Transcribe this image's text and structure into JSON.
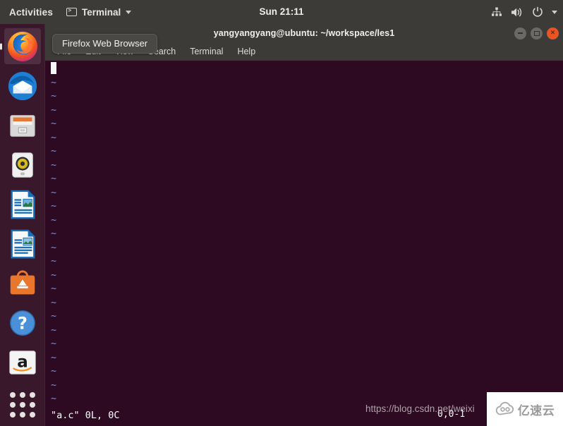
{
  "topbar": {
    "activities": "Activities",
    "app_name": "Terminal",
    "app_icon": "terminal-icon",
    "clock": "Sun 21:11",
    "tray": [
      {
        "name": "network-icon",
        "label": "Network"
      },
      {
        "name": "volume-icon",
        "label": "Volume"
      },
      {
        "name": "power-icon",
        "label": "Power"
      },
      {
        "name": "chevron-down-icon",
        "label": "System menu"
      }
    ]
  },
  "dock": {
    "items": [
      {
        "name": "firefox",
        "label": "Firefox Web Browser",
        "active": true
      },
      {
        "name": "thunderbird",
        "label": "Thunderbird Mail",
        "active": false
      },
      {
        "name": "files",
        "label": "Files",
        "active": false
      },
      {
        "name": "rhythmbox",
        "label": "Rhythmbox",
        "active": false
      },
      {
        "name": "libreoffice-impress",
        "label": "LibreOffice Impress",
        "active": false
      },
      {
        "name": "libreoffice-writer",
        "label": "LibreOffice Writer",
        "active": false
      },
      {
        "name": "ubuntu-software",
        "label": "Ubuntu Software",
        "active": false
      },
      {
        "name": "help",
        "label": "Help",
        "active": false
      },
      {
        "name": "amazon",
        "label": "Amazon",
        "active": false
      }
    ],
    "show_applications": "Show Applications"
  },
  "tooltip": {
    "text": "Firefox Web Browser"
  },
  "window": {
    "title": "yangyangyang@ubuntu: ~/workspace/les1",
    "buttons": {
      "minimize": "Minimize",
      "maximize": "Maximize",
      "close": "Close"
    },
    "menu": [
      {
        "label": "File"
      },
      {
        "label": "Edit"
      },
      {
        "label": "View"
      },
      {
        "label": "Search"
      },
      {
        "label": "Terminal"
      },
      {
        "label": "Help"
      }
    ]
  },
  "terminal": {
    "background": "#2d0922",
    "foreground": "#ffffff",
    "tilde_color": "#7d8fd6",
    "empty_line_marker": "~",
    "empty_line_count": 25,
    "status_line": "\"a.c\" 0L, 0C",
    "cursor_position": "0,0-1"
  },
  "watermark": {
    "url": "https://blog.csdn.net/weixi",
    "badge_text": "亿速云",
    "badge_icon": "cloud-icon"
  }
}
